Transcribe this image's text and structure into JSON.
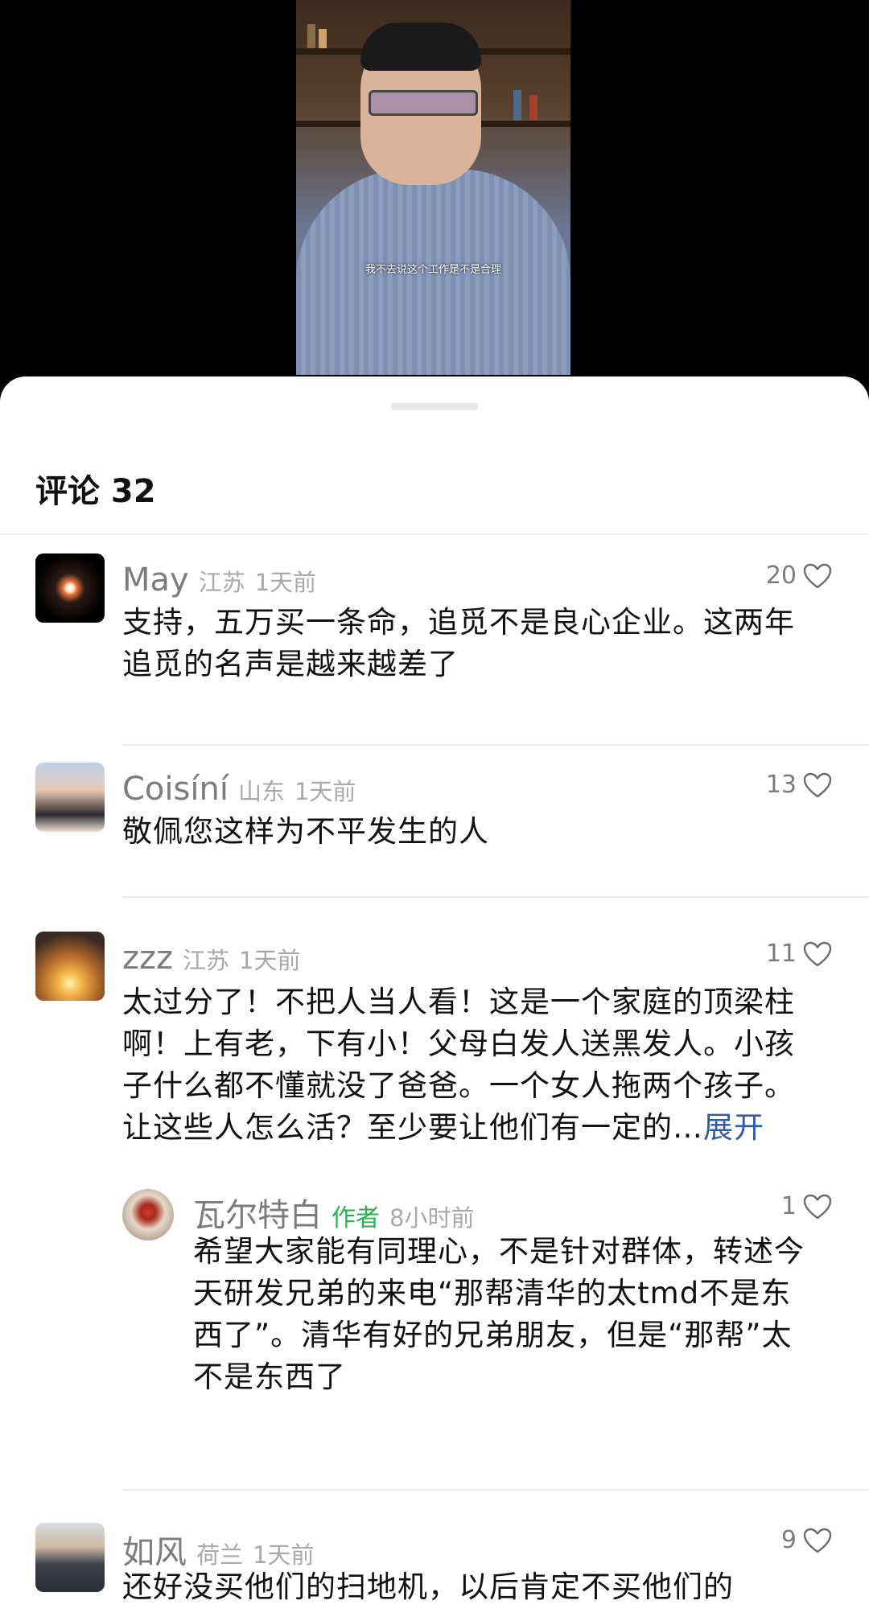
{
  "video": {
    "subtitle": "我不去说这个工作是不是合理"
  },
  "comments_panel": {
    "title": "评论 32",
    "comments": [
      {
        "user": "May",
        "location": "江苏",
        "time": "1天前",
        "likes": "20",
        "avatar_icon": "firework-avatar",
        "text_lines": [
          "支持，五万买一条命，追觅不是良心企业。这两年",
          "追觅的名声是越来越差了"
        ]
      },
      {
        "user": "Coisíní",
        "location": "山东",
        "time": "1天前",
        "likes": "13",
        "avatar_icon": "woman-photo-avatar",
        "text_lines": [
          "敬佩您这样为不平发生的人"
        ]
      },
      {
        "user": "zzz",
        "location": "江苏",
        "time": "1天前",
        "likes": "11",
        "avatar_icon": "sunset-couple-avatar",
        "text_lines": [
          "太过分了！不把人当人看！这是一个家庭的顶梁柱",
          "啊！上有老，下有小！父母白发人送黑发人。小孩",
          "子什么都不懂就没了爸爸。一个女人拖两个孩子。",
          "让这些人怎么活？至少要让他们有一定的…"
        ],
        "expand": "展开",
        "reply": {
          "user": "瓦尔特白",
          "author_tag": "作者",
          "time": "8小时前",
          "likes": "1",
          "avatar_icon": "author-avatar",
          "text_lines": [
            "希望大家能有同理心，不是针对群体，转述今",
            "天研发兄弟的来电“那帮清华的太tmd不是东",
            "西了”。清华有好的兄弟朋友，但是“那帮”太",
            "不是东西了"
          ]
        }
      },
      {
        "user": "如风",
        "location": "荷兰",
        "time": "1天前",
        "likes": "9",
        "avatar_icon": "man-photo-avatar",
        "text_lines": [
          "还好没买他们的扫地机，以后肯定不买他们的"
        ]
      }
    ]
  },
  "colors": {
    "author_tag": "#2ab24a",
    "expand_link": "#2f5aa8",
    "meta_gray": "#a9a9a9"
  }
}
